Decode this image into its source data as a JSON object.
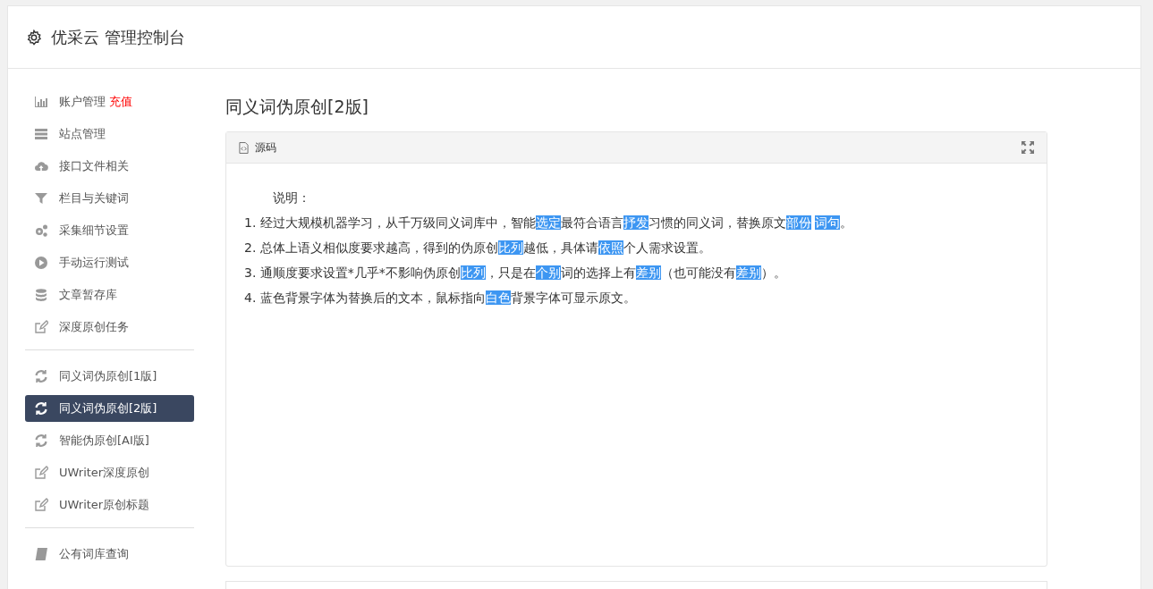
{
  "header": {
    "title": "优采云 管理控制台"
  },
  "sidebar": {
    "groups": [
      {
        "items": [
          {
            "label": "账户管理",
            "badge": "充值",
            "selected": false
          },
          {
            "label": "站点管理",
            "selected": false
          },
          {
            "label": "接口文件相关",
            "selected": false
          },
          {
            "label": "栏目与关键词",
            "selected": false
          },
          {
            "label": "采集细节设置",
            "selected": false
          },
          {
            "label": "手动运行测试",
            "selected": false
          },
          {
            "label": "文章暂存库",
            "selected": false
          },
          {
            "label": "深度原创任务",
            "selected": false
          }
        ]
      },
      {
        "items": [
          {
            "label": "同义词伪原创[1版]",
            "selected": false
          },
          {
            "label": "同义词伪原创[2版]",
            "selected": true
          },
          {
            "label": "智能伪原创[AI版]",
            "selected": false
          },
          {
            "label": "UWriter深度原创",
            "selected": false
          },
          {
            "label": "UWriter原创标题",
            "selected": false
          }
        ]
      },
      {
        "items": [
          {
            "label": "公有词库查询",
            "selected": false
          }
        ]
      }
    ]
  },
  "page_title": "同义词伪原创[2版]",
  "panel": {
    "tab": "源码",
    "intro": "说明：",
    "lines": [
      [
        {
          "text": "1. 经过大规模机器学习，从千万级同义词库中，智能",
          "highlighted": false
        },
        {
          "text": "选定",
          "highlighted": true
        },
        {
          "text": "最符合语言",
          "highlighted": false
        },
        {
          "text": "抒发",
          "highlighted": true
        },
        {
          "text": "习惯的同义词，替换原文",
          "highlighted": false
        },
        {
          "text": "部份",
          "highlighted": true
        },
        {
          "text": "词句",
          "highlighted": true
        },
        {
          "text": "。",
          "highlighted": false
        }
      ],
      [
        {
          "text": "2. 总体上语义相似度要求越高，得到的伪原创",
          "highlighted": false
        },
        {
          "text": "比列",
          "highlighted": true
        },
        {
          "text": "越低，具体请",
          "highlighted": false
        },
        {
          "text": "依照",
          "highlighted": true
        },
        {
          "text": "个人需求设置。",
          "highlighted": false
        }
      ],
      [
        {
          "text": "3. 通顺度要求设置*几乎*不影响伪原创",
          "highlighted": false
        },
        {
          "text": "比列",
          "highlighted": true
        },
        {
          "text": "，只是在",
          "highlighted": false
        },
        {
          "text": "个别",
          "highlighted": true
        },
        {
          "text": "词的选择上有",
          "highlighted": false
        },
        {
          "text": "差别",
          "highlighted": true
        },
        {
          "text": "（也可能没有",
          "highlighted": false
        },
        {
          "text": "差别",
          "highlighted": true
        },
        {
          "text": "）。",
          "highlighted": false
        }
      ],
      [
        {
          "text": "4. 蓝色背景字体为替换后的文本，鼠标指向",
          "highlighted": false
        },
        {
          "text": "白色",
          "highlighted": true
        },
        {
          "text": "背景字体可显示原文。",
          "highlighted": false
        }
      ]
    ]
  }
}
